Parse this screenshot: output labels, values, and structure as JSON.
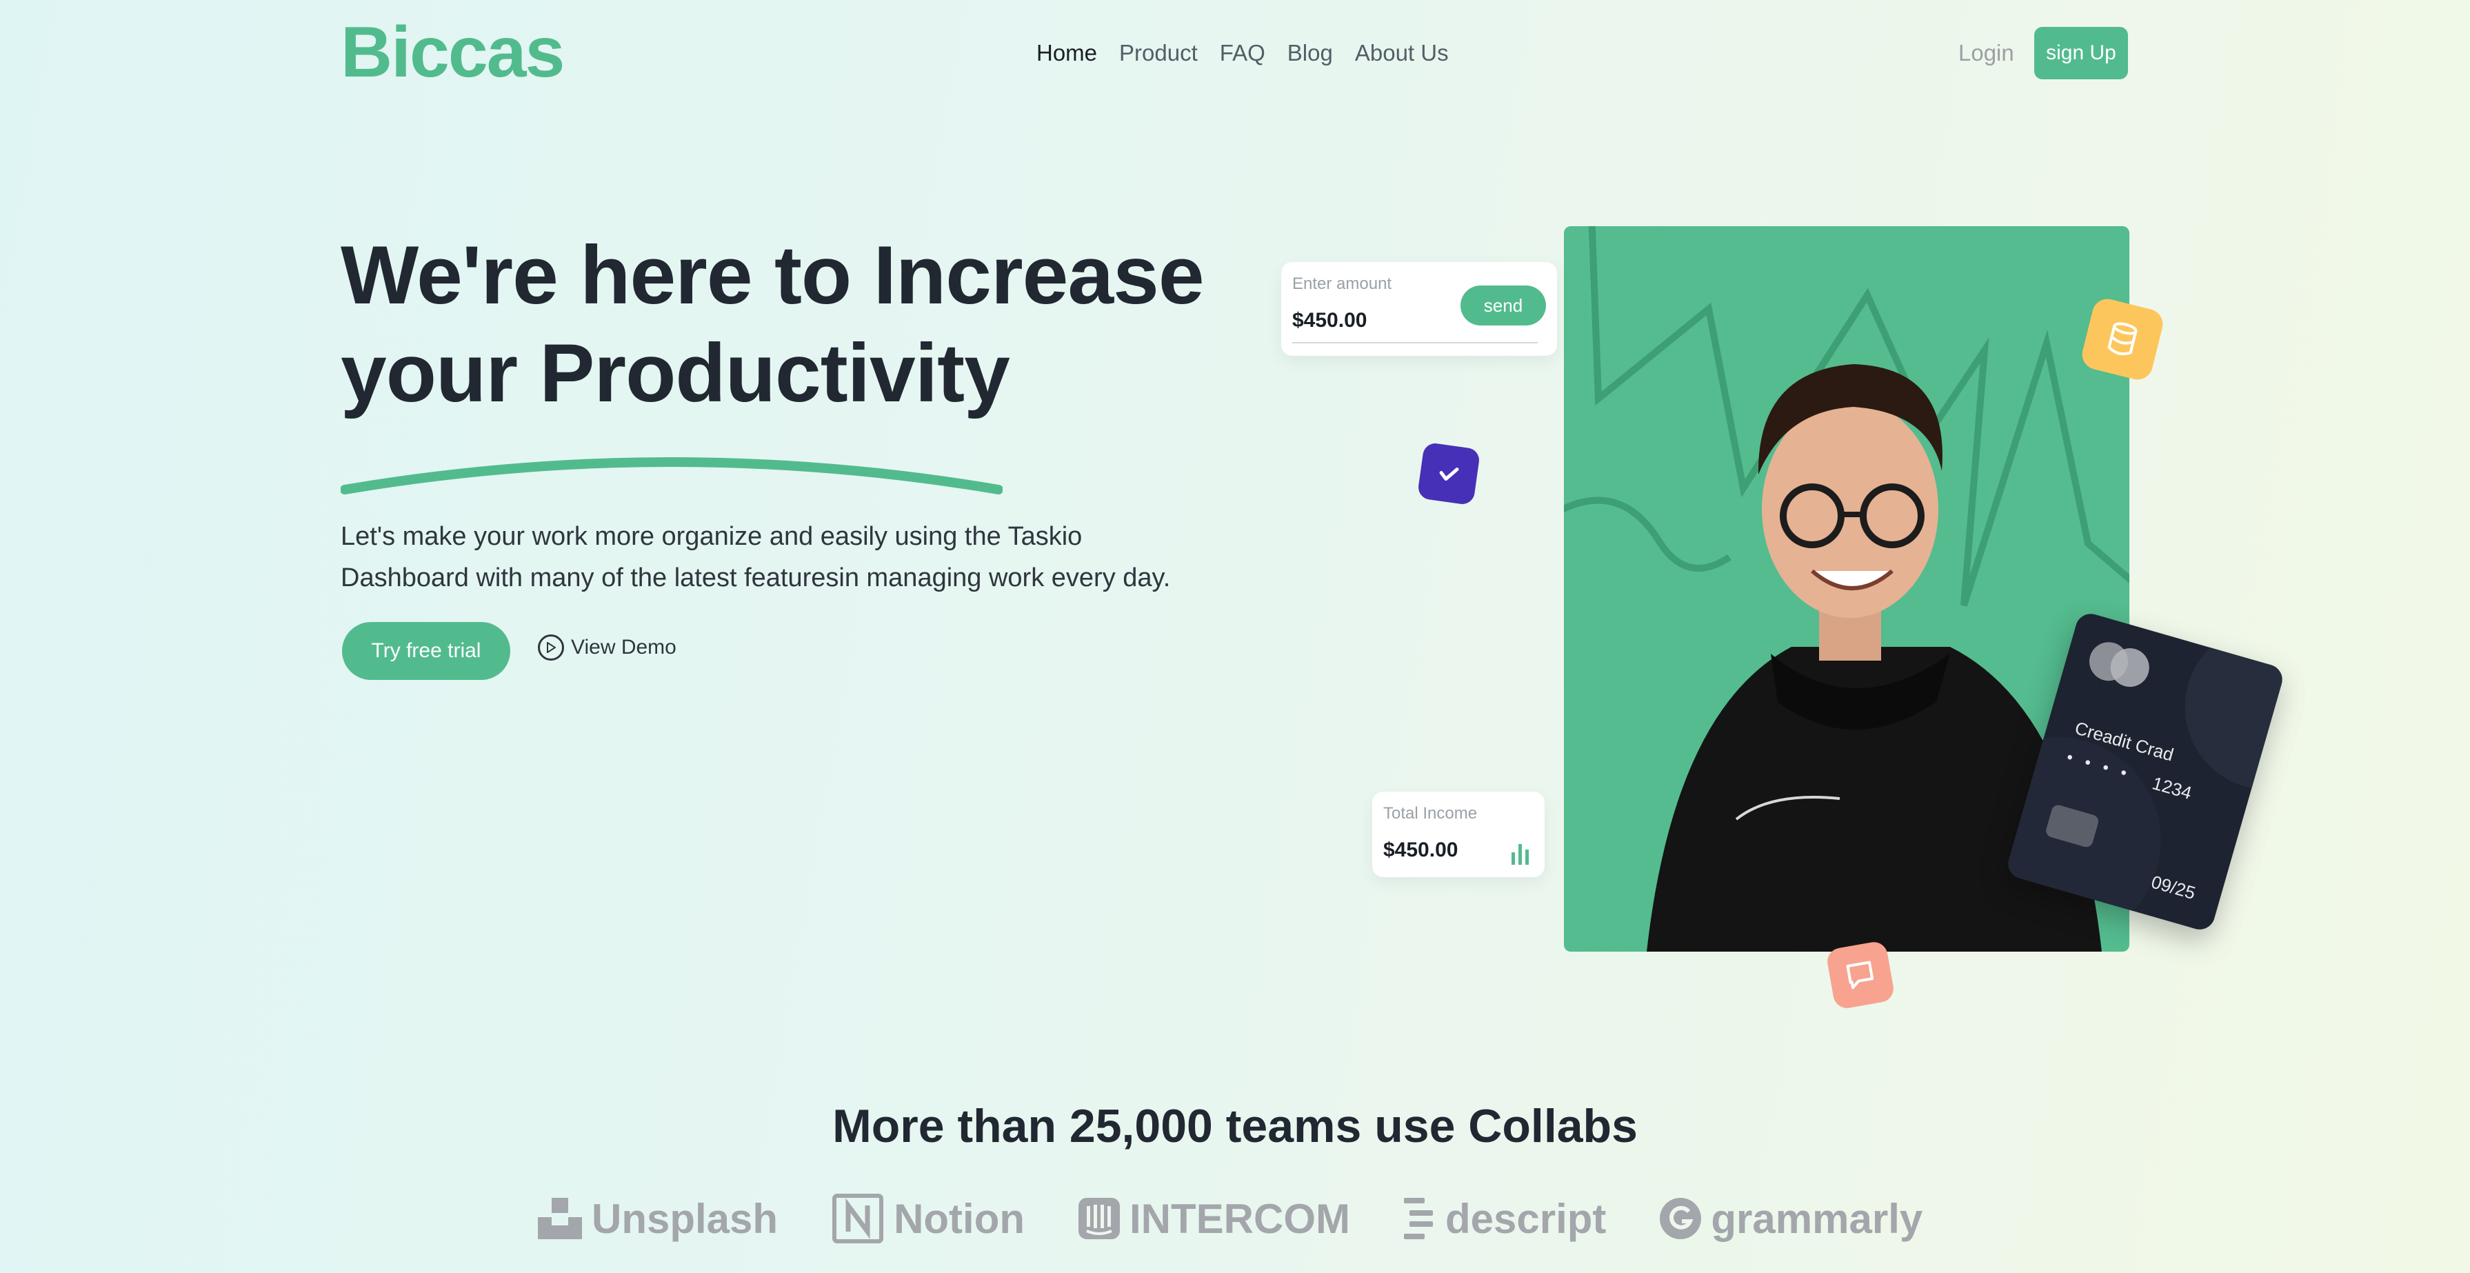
{
  "header": {
    "logo": "Biccas",
    "nav": [
      "Home",
      "Product",
      "FAQ",
      "Blog",
      "About Us"
    ],
    "active_nav": "Home",
    "login": "Login",
    "signup": "sign Up"
  },
  "hero": {
    "title_line1": "We're here to Increase",
    "title_line2": "your Productivity",
    "text_line1": "Let's make your work more organize and easily using the Taskio",
    "text_line2": "Dashboard with many of the latest featuresin managing work every day.",
    "trial_button": "Try free trial",
    "demo_link": "View Demo"
  },
  "send_card": {
    "label": "Enter amount",
    "value": "$450.00",
    "button": "send"
  },
  "income_card": {
    "label": "Total Income",
    "value": "$450.00"
  },
  "credit_card": {
    "name": "Creadit Crad",
    "dots": "• • • •",
    "digits": "1234",
    "expiry": "09/25"
  },
  "teams": {
    "title": "More than 25,000 teams use Collabs",
    "logos": [
      "Unsplash",
      "Notion",
      "INTERCOM",
      "descript",
      "grammarly"
    ]
  },
  "colors": {
    "accent": "#52bb8e",
    "dark": "#212832",
    "purple": "#4630b8",
    "yellow": "#fdc65c",
    "salmon": "#f7a38f",
    "logo_gray": "#a3a6aa"
  },
  "icons": {
    "check_badge": "check-icon",
    "db_badge": "database-icon",
    "chat_badge": "chat-icon",
    "income": "bar-chart-icon",
    "demo": "play-icon"
  }
}
